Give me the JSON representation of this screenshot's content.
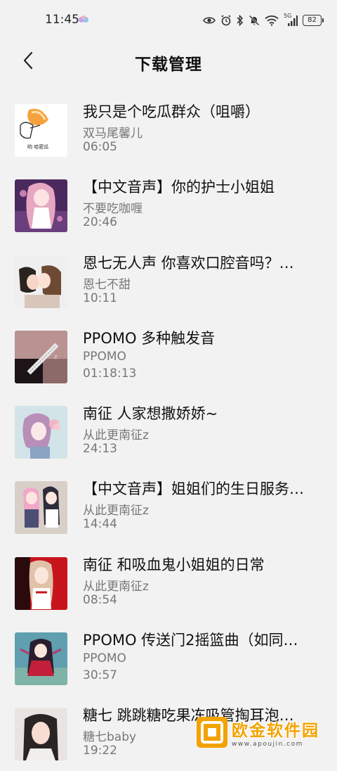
{
  "status_bar": {
    "time": "11:45",
    "network_label": "5G",
    "battery": "82"
  },
  "header": {
    "title": "下载管理"
  },
  "items": [
    {
      "title": "我只是个吃瓜群众（咀嚼）",
      "author": "双马尾馨儿",
      "duration": "06:05",
      "thumb_caption": "哟 哈密瓜"
    },
    {
      "title": "【中文音声】你的护士小姐姐",
      "author": "不要吃咖喱",
      "duration": "20:46"
    },
    {
      "title": "恩七无人声 你喜欢口腔音吗？…",
      "author": "恩七不甜",
      "duration": "10:11"
    },
    {
      "title": "PPOMO 多种触发音",
      "author": "PPOMO",
      "duration": "01:18:13"
    },
    {
      "title": "南征 人家想撒娇娇~",
      "author": "从此更南征z",
      "duration": "24:13"
    },
    {
      "title": "【中文音声】姐姐们的生日服务…",
      "author": "从此更南征z",
      "duration": "14:44"
    },
    {
      "title": "南征 和吸血鬼小姐姐的日常",
      "author": "从此更南征z",
      "duration": "08:54"
    },
    {
      "title": "PPOMO 传送门2摇篮曲（如同…",
      "author": "PPOMO",
      "duration": "30:57"
    },
    {
      "title": "糖七 跳跳糖吃果冻吸管掏耳泡…",
      "author": "糖七baby",
      "duration": "19:22"
    }
  ],
  "watermark": {
    "name": "欧金软件园",
    "url": "www.apoujin.com"
  },
  "colors": {
    "background": "#f2f2f2",
    "secondary_text": "#777777",
    "watermark_accent": "#f2a300"
  }
}
